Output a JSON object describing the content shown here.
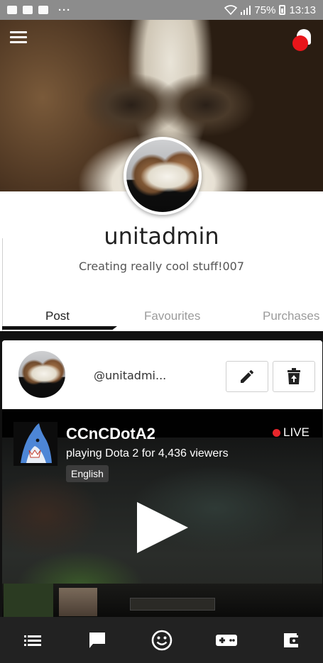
{
  "status_bar": {
    "battery": "75%",
    "time": "13:13",
    "overflow": "···"
  },
  "header": {
    "menu_icon": "hamburger-menu-icon",
    "notification_icon": "bell-icon"
  },
  "profile": {
    "username": "unitadmin",
    "bio": "Creating really cool stuff!007"
  },
  "tabs": [
    {
      "label": "Post",
      "active": true
    },
    {
      "label": "Favourites",
      "active": false
    },
    {
      "label": "Purchases",
      "active": false
    }
  ],
  "post": {
    "handle": "@unitadmi...",
    "edit_icon": "pencil-icon",
    "delete_icon": "trash-icon",
    "stream": {
      "channel": "CCnCDotA2",
      "live_label": "LIVE",
      "status": "playing Dota 2 for 4,436 viewers",
      "language": "English"
    }
  },
  "bottom_nav": [
    {
      "icon": "list-icon"
    },
    {
      "icon": "chat-icon"
    },
    {
      "icon": "smiley-icon"
    },
    {
      "icon": "gamepad-icon"
    },
    {
      "icon": "wallet-icon"
    }
  ],
  "colors": {
    "accent_live": "#e8262b",
    "notification_badge": "#e8151a",
    "nav_background": "#222222",
    "status_bar": "#8c8c8c"
  }
}
